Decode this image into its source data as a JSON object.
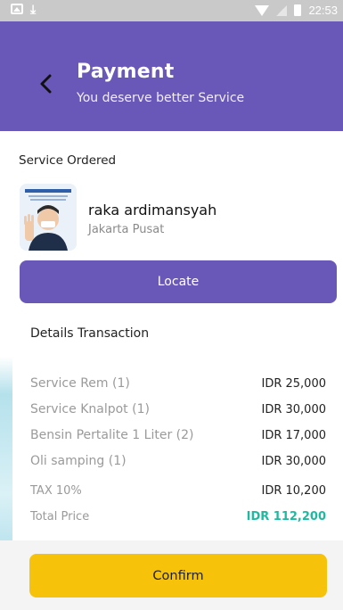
{
  "status_bar": {
    "time": "22:53",
    "icons": [
      "image-icon",
      "download-icon",
      "wifi-icon",
      "signal-icon",
      "battery-icon"
    ]
  },
  "header": {
    "title": "Payment",
    "subtitle": "You deserve better Service",
    "background_color": "#6a58b8"
  },
  "service": {
    "section_label": "Service Ordered",
    "provider_name": "raka ardimansyah",
    "provider_location": "Jakarta Pusat",
    "locate_label": "Locate"
  },
  "details": {
    "title": "Details Transaction",
    "items": [
      {
        "name": "Service Rem (1)",
        "price": "IDR 25,000"
      },
      {
        "name": "Service Knalpot (1)",
        "price": "IDR 30,000"
      },
      {
        "name": "Bensin Pertalite 1 Liter (2)",
        "price": "IDR 17,000"
      },
      {
        "name": "Oli samping (1)",
        "price": "IDR 30,000"
      }
    ],
    "tax": {
      "label": "TAX 10%",
      "value": "IDR 10,200"
    },
    "total": {
      "label": "Total Price",
      "value": "IDR 112,200",
      "color": "#1fb9a0"
    }
  },
  "footer": {
    "confirm_label": "Confirm",
    "confirm_color": "#f7c20a"
  }
}
